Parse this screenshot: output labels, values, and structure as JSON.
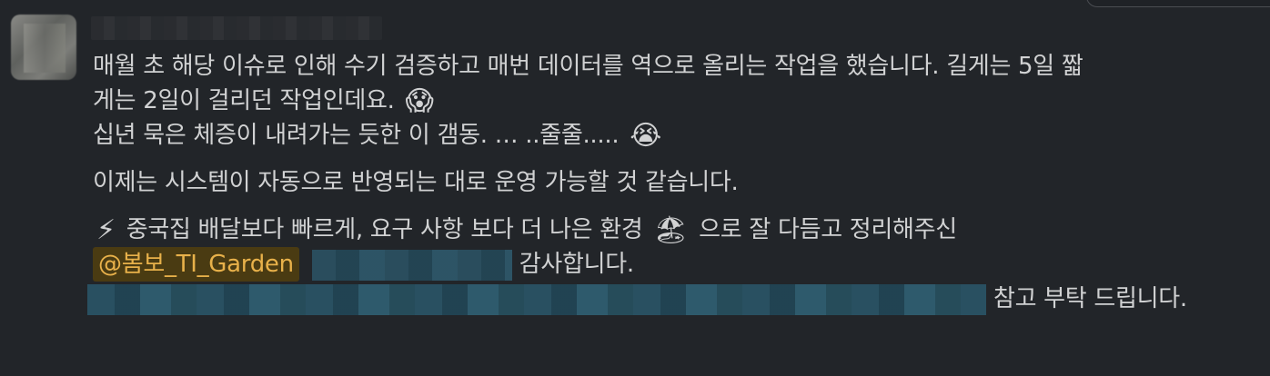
{
  "message": {
    "line1": "매월 초 해당 이슈로 인해 수기 검증하고 매번 데이터를 역으로 올리는 작업을 했습니다. 길게는 5일 짧",
    "line2": "게는 2일이 걸리던 작업인데요.",
    "line2_emoji": "😱",
    "line3": "십년 묵은 체증이 내려가는 듯한 이 갬동. …  ..줄줄.....",
    "line3_emoji": "😭",
    "line4": "이제는 시스템이 자동으로 반영되는 대로 운영 가능할 것 같습니다.",
    "line5_emoji_lead": "⚡",
    "line5_text1": "중국집 배달보다 빠르게, 요구 사항 보다 더 나은 환경",
    "line5_emoji_mid": "🏖",
    "line5_text2": "으로 잘 다듬고 정리해주신",
    "mention": "@봄보_TI_Garden",
    "line6_text": "감사합니다.",
    "line7_text": "참고 부탁 드립니다."
  },
  "colors": {
    "background": "#222529",
    "text": "#d1d2d3",
    "mention_bg": "#4a3b12",
    "mention_text": "#e8b14a"
  }
}
